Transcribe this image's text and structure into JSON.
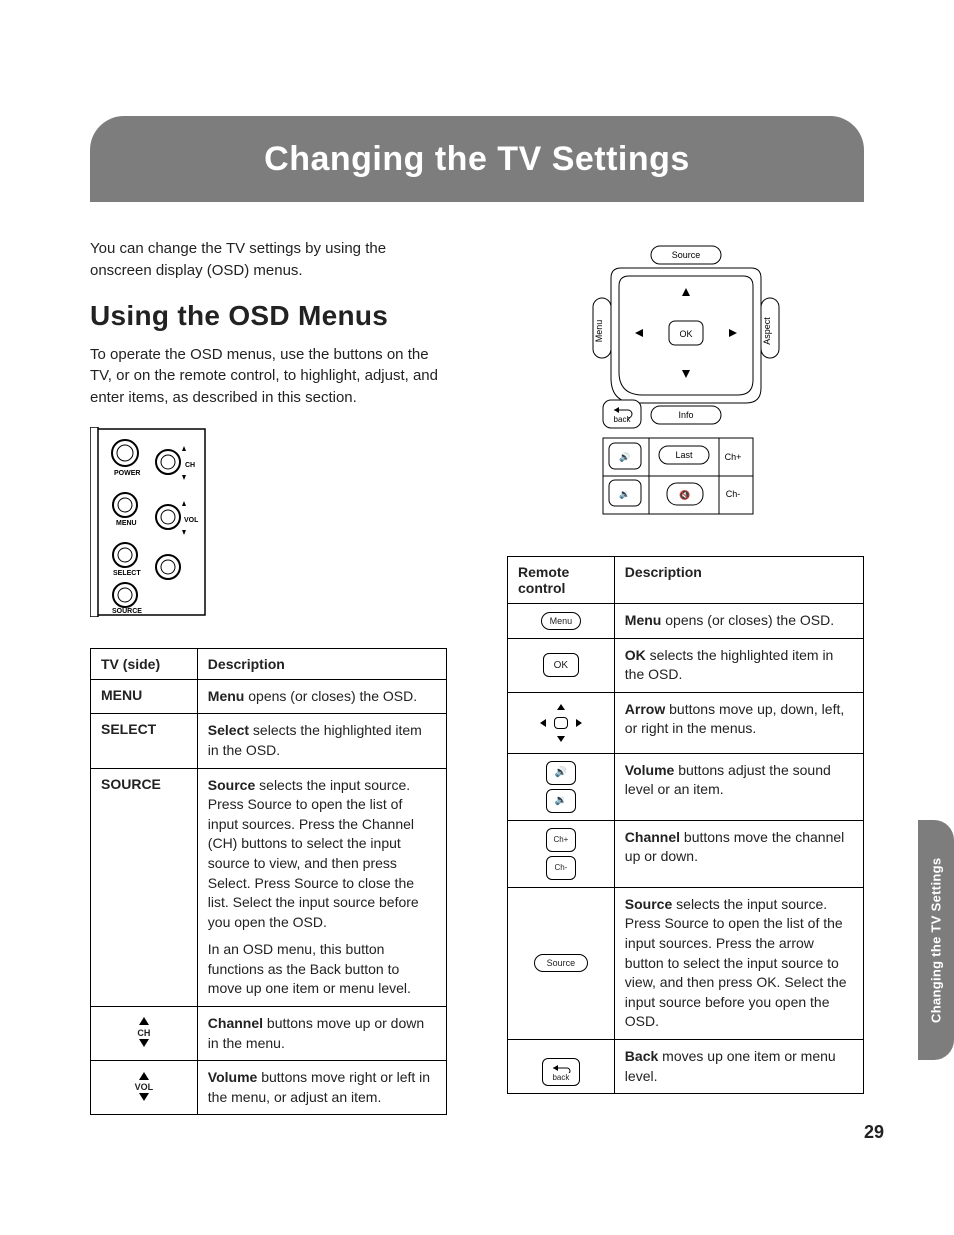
{
  "title": "Changing the TV Settings",
  "intro": "You can change the TV settings by using the onscreen display (OSD) menus.",
  "section_heading": "Using the OSD Menus",
  "section_para": "To operate the OSD menus, use the buttons on the TV, or on the remote control, to highlight, adjust, and enter items, as described in this section.",
  "side_panel_labels": {
    "power": "POWER",
    "ch": "CH",
    "menu": "MENU",
    "vol": "VOL",
    "select": "SELECT",
    "source": "SOURCE"
  },
  "tv_table": {
    "headers": [
      "TV (side)",
      "Description"
    ],
    "rows": [
      {
        "label": "MENU",
        "desc_bold": "Menu",
        "desc_rest": " opens (or closes) the OSD."
      },
      {
        "label": "SELECT",
        "desc_bold": "Select",
        "desc_rest": " selects the highlighted item in the OSD."
      },
      {
        "label": "SOURCE",
        "desc_bold": "Source",
        "desc_rest": " selects the input source. Press Source to open the list of input sources. Press the Channel (CH) buttons to select the input source to view, and then press Select. Press Source to close the list. Select the input source before you open the OSD.",
        "extra": "In an OSD menu, this button functions as the Back button to move up one item or menu level."
      },
      {
        "label": "CH",
        "icon": "chvol",
        "desc_bold": "Channel",
        "desc_rest": " buttons move up or down in the menu."
      },
      {
        "label": "VOL",
        "icon": "chvol",
        "desc_bold": "Volume",
        "desc_rest": " buttons move right or left in the menu, or adjust an item."
      }
    ]
  },
  "remote_labels": {
    "source": "Source",
    "menu": "Menu",
    "ok": "OK",
    "aspect": "Aspect",
    "back": "back",
    "info": "Info",
    "last": "Last",
    "chp": "Ch+",
    "chm": "Ch-"
  },
  "remote_table": {
    "headers": [
      "Remote control",
      "Description"
    ],
    "rows": [
      {
        "icon": "menu",
        "desc_bold": "Menu",
        "desc_rest": " opens (or closes) the OSD."
      },
      {
        "icon": "ok",
        "desc_bold": "OK",
        "desc_rest": " selects the highlighted item in the OSD."
      },
      {
        "icon": "arrows",
        "desc_bold": "Arrow",
        "desc_rest": " buttons move up, down, left, or right in the menus."
      },
      {
        "icon": "volume",
        "desc_bold": "Volume",
        "desc_rest": " buttons adjust the sound level or an item."
      },
      {
        "icon": "channel",
        "desc_bold": "Channel",
        "desc_rest": " buttons move the channel up or down."
      },
      {
        "icon": "source",
        "desc_bold": "Source",
        "desc_rest": " selects the input source. Press Source to open the list of the input sources. Press the arrow button to select the input source to view, and then press OK. Select the input source before you open the OSD."
      },
      {
        "icon": "back",
        "desc_bold": "Back",
        "desc_rest": " moves up one item or menu level."
      }
    ]
  },
  "side_tab": "Changing the TV Settings",
  "page_number": "29"
}
